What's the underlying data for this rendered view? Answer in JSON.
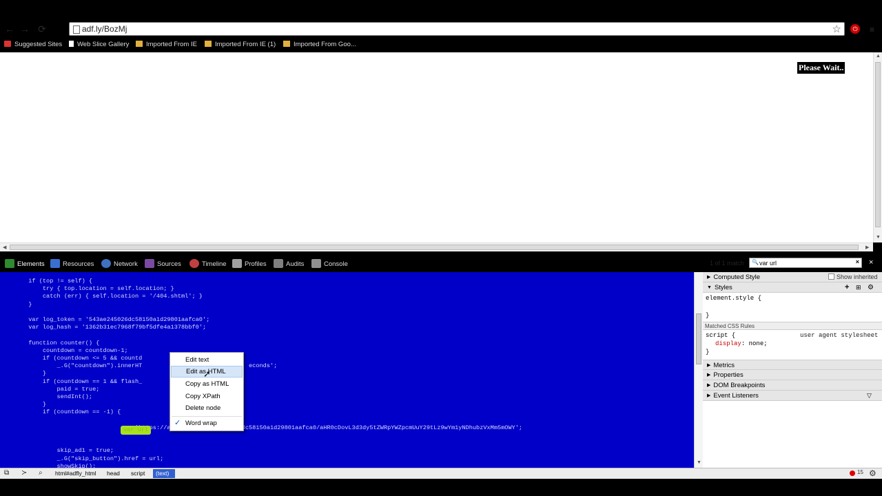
{
  "browser": {
    "url": "adf.ly/BozMj",
    "back_glyph": "←",
    "forward_glyph": "→",
    "reload_glyph": "⟳",
    "star_glyph": "☆",
    "menu_glyph": "≡",
    "extension_glyph": "⏻"
  },
  "bookmarks": [
    {
      "label": "Suggested Sites",
      "icon": "red-shield-icon"
    },
    {
      "label": "Web Slice Gallery",
      "icon": "page-icon"
    },
    {
      "label": "Imported From IE",
      "icon": "folder-icon"
    },
    {
      "label": "Imported From IE (1)",
      "icon": "folder-icon"
    },
    {
      "label": "Imported From Goo...",
      "icon": "folder-icon"
    }
  ],
  "page": {
    "please_wait": "Please Wait.."
  },
  "devtools": {
    "tabs": [
      {
        "label": "Elements",
        "color": "#2e8b2e",
        "active": true
      },
      {
        "label": "Resources",
        "color": "#3a6fd0"
      },
      {
        "label": "Network",
        "color": "#4070c0"
      },
      {
        "label": "Sources",
        "color": "#7a4aa0"
      },
      {
        "label": "Timeline",
        "color": "#c04040"
      },
      {
        "label": "Profiles",
        "color": "#a0a0a0"
      },
      {
        "label": "Audits",
        "color": "#808080"
      },
      {
        "label": "Console",
        "color": "#909090"
      }
    ],
    "search_value": "var url",
    "matches_text": "1 of 1 match",
    "close_glyph": "×",
    "code_lines": [
      "        if (top != self) {",
      "            try { top.location = self.location; }",
      "            catch (err) { self.location = '/404.shtml'; }",
      "        }",
      "",
      "        var log_token = '543ae245026dc58150a1d29801aafca0';",
      "        var log_hash = '1362b31ec7968f79bf5dfe4a1378bbf0';",
      "",
      "        function counter() {",
      "            countdown = countdown-1;",
      "            if (countdown <= 5 && countd",
      "                _.G(\"countdown\").innerHT                              econds';",
      "            }",
      "            if (countdown == 1 && flash_",
      "                paid = true;",
      "                sendInt();",
      "            }",
      "            if (countdown == -1) {",
      "",
      "                                    = 'https://adf.ly/go/543ae245026dc58150a1d29801aafca0/aHR0cDovL3d3dy5tZWRpYWZpcmUuY29tLz9wYm1yNDhubzVxMm5mOWY';",
      "",
      "",
      "                skip_ad1 = true;",
      "                _.G(\"skip_button\").href = url;",
      "                showSkip();"
    ],
    "highlight_text": "var url"
  },
  "context_menu": {
    "items": [
      "Edit text",
      "Edit as HTML",
      "Copy as HTML",
      "Copy XPath",
      "Delete node",
      "Word wrap"
    ],
    "check_glyph": "✓"
  },
  "sidebar": {
    "computed_style": "Computed Style",
    "show_inherited": "Show inherited",
    "styles": "Styles",
    "element_style_open": "element.style {",
    "element_style_close": "}",
    "matched_rules": "Matched CSS Rules",
    "rule_selector": "script {",
    "rule_source": "user agent stylesheet",
    "rule_prop": "display",
    "rule_value": "none;",
    "rule_close": "}",
    "metrics": "Metrics",
    "properties": "Properties",
    "dom_breakpoints": "DOM Breakpoints",
    "event_listeners": "Event Listeners"
  },
  "breadcrumbs": [
    "html#adfly_html",
    "head",
    "script",
    "(text)"
  ],
  "status": {
    "error_count": "15"
  }
}
